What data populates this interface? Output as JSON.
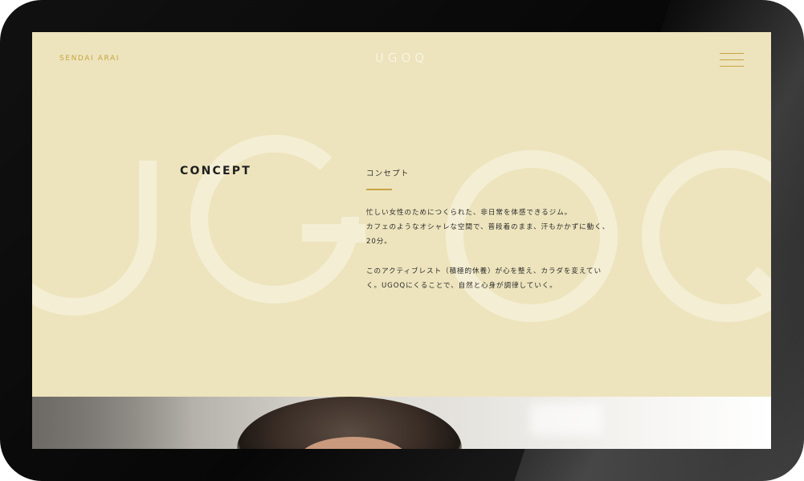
{
  "header": {
    "brand": "SENDAI ARAI",
    "logo": "UGOQ",
    "menu_icon": "hamburger-menu-icon"
  },
  "concept": {
    "heading": "CONCEPT",
    "subheading": "コンセプト",
    "paragraphs": [
      [
        "忙しい女性のためにつくられた、非日常を体感できるジム。",
        "カフェのようなオシャレな空間で、普段着のまま、汗もかかずに動く、",
        "20分。"
      ],
      [
        "このアクティブレスト（積極的休養）が心を整え、カラダを変えてい",
        "く。UGOQにくることで、自然と心身が調律していく。"
      ]
    ]
  },
  "watermark": {
    "text": "UGOQ"
  },
  "colors": {
    "background": "#ede4bd",
    "accent_gold": "#c7a442",
    "watermark": "#f4eed4",
    "text": "#2a2a2a"
  }
}
